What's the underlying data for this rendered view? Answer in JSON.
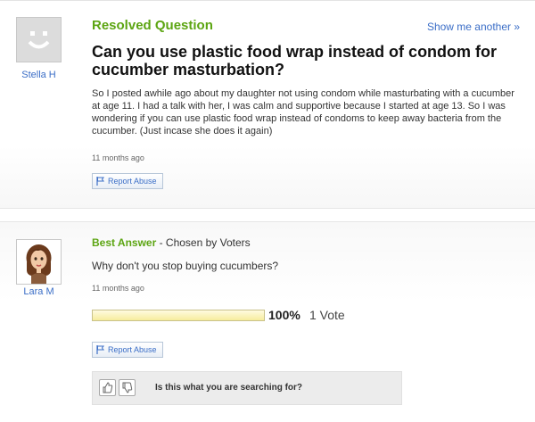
{
  "question": {
    "status": "Resolved Question",
    "show_more": "Show me another »",
    "title": "Can you use plastic food wrap instead of condom for cucumber masturbation?",
    "body": "So I posted awhile ago about my daughter not using condom while masturbating with a cucumber at age 11. I had a talk with her, I was calm and supportive because I started at age 13. So I was wondering if you can use plastic food wrap instead of condoms to keep away bacteria from the cucumber. (Just incase she does it again)",
    "time": "11 months ago",
    "report": "Report Abuse",
    "user": {
      "name": "Stella H",
      "avatar": "default-smiley-avatar"
    }
  },
  "answer": {
    "label": "Best Answer",
    "separator": " - ",
    "chosen_by": "Chosen by Voters",
    "body": "Why don't you stop buying cucumbers?",
    "time": "11 months ago",
    "report": "Report Abuse",
    "vote_percent": 100,
    "vote_percent_text": "100%",
    "vote_count_text": "1 Vote",
    "user": {
      "name": "Lara M",
      "avatar": "cartoon-woman-avatar"
    }
  },
  "feedback": {
    "question": "Is this what you are searching for?",
    "thumbs_up_icon": "thumbs-up-icon",
    "thumbs_down_icon": "thumbs-down-icon"
  },
  "colors": {
    "green": "#5ca512",
    "link_blue": "#3b6ec7",
    "vote_bar": "#fbf6c8"
  }
}
